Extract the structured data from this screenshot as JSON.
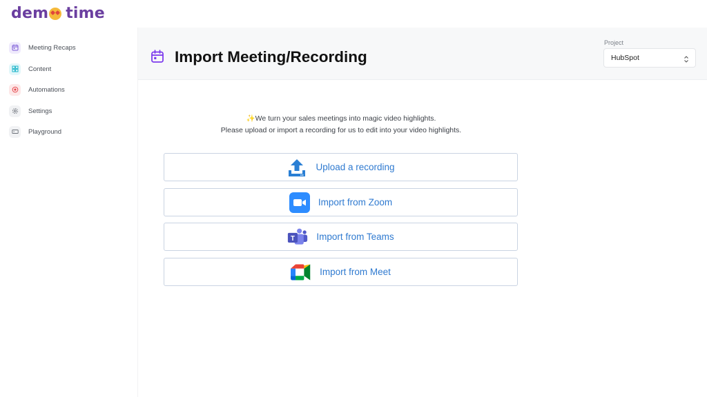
{
  "app": {
    "logo_text_left": "dem",
    "logo_text_right": "time"
  },
  "sidebar": {
    "items": [
      {
        "label": "Meeting Recaps",
        "icon": "calendar-icon",
        "color": "#7c5cd6",
        "bg": "#efeafc"
      },
      {
        "label": "Content",
        "icon": "layout-icon",
        "color": "#1fb5c9",
        "bg": "#e2f7fa"
      },
      {
        "label": "Automations",
        "icon": "record-icon",
        "color": "#e5484d",
        "bg": "#fde8e8"
      },
      {
        "label": "Settings",
        "icon": "gear-icon",
        "color": "#6b7078",
        "bg": "#f1f2f4"
      },
      {
        "label": "Playground",
        "icon": "keyboard-icon",
        "color": "#6b7078",
        "bg": "#f1f2f4"
      }
    ]
  },
  "header": {
    "title": "Import Meeting/Recording",
    "icon": "calendar-icon",
    "accent": "#7c3aed",
    "project_label": "Project",
    "project_value": "HubSpot"
  },
  "main": {
    "tagline_line1": "We turn your sales meetings into magic video highlights.",
    "tagline_sparkle": "✨",
    "tagline_line2": "Please upload or import a recording for us to edit into your video highlights.",
    "buttons": [
      {
        "label": "Upload a recording",
        "icon": "upload-icon"
      },
      {
        "label": "Import from Zoom",
        "icon": "zoom-icon"
      },
      {
        "label": "Import from Teams",
        "icon": "teams-icon"
      },
      {
        "label": "Import from Meet",
        "icon": "meet-icon"
      }
    ],
    "link_color": "#2f7ad0"
  }
}
